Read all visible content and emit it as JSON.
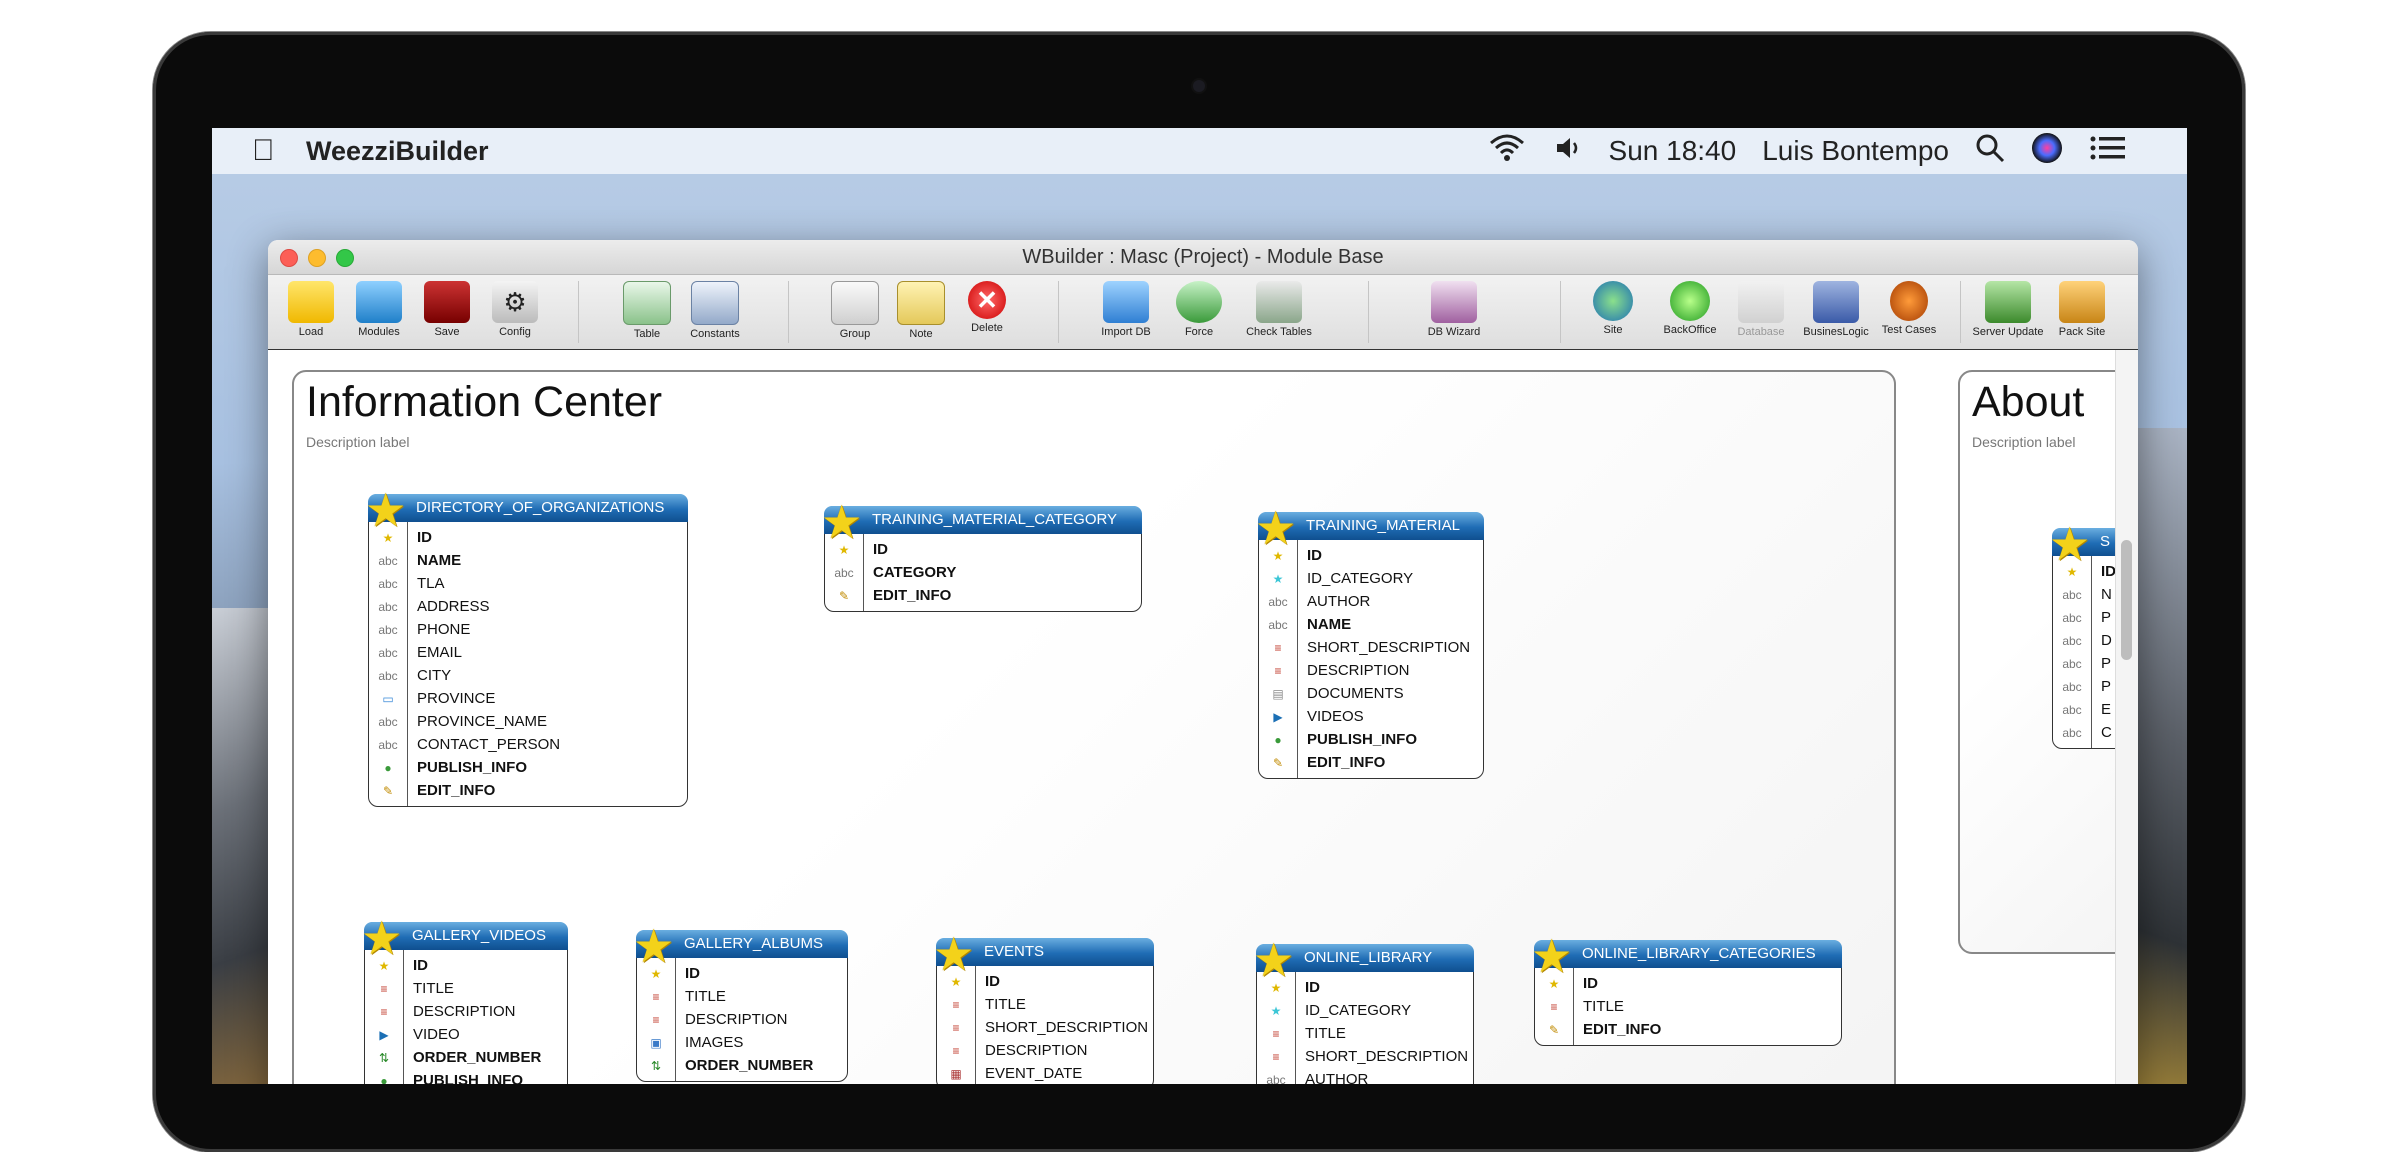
{
  "menubar": {
    "app_name": "WeezziBuilder",
    "clock": "Sun 18:40",
    "user": "Luis Bontempo"
  },
  "window": {
    "title": "WBuilder : Masc (Project) - Module Base"
  },
  "toolbar": {
    "load": "Load",
    "modules": "Modules",
    "save": "Save",
    "config": "Config",
    "table": "Table",
    "constants": "Constants",
    "group": "Group",
    "note": "Note",
    "delete": "Delete",
    "import_db": "Import DB",
    "force": "Force",
    "check_tables": "Check Tables",
    "db_wizard": "DB Wizard",
    "site": "Site",
    "backoffice": "BackOffice",
    "database": "Database",
    "businesslogic": "BusinesLogic",
    "test_cases": "Test Cases",
    "server_update": "Server Update",
    "pack_site": "Pack Site"
  },
  "groups": {
    "info": {
      "title": "Information Center",
      "desc": "Description label"
    },
    "about": {
      "title": "About",
      "desc": "Description label"
    }
  },
  "entities": {
    "directory": {
      "name": "DIRECTORY_OF_ORGANIZATIONS",
      "fields": [
        "ID",
        "NAME",
        "TLA",
        "ADDRESS",
        "PHONE",
        "EMAIL",
        "CITY",
        "PROVINCE",
        "PROVINCE_NAME",
        "CONTACT_PERSON",
        "PUBLISH_INFO",
        "EDIT_INFO"
      ]
    },
    "training_cat": {
      "name": "TRAINING_MATERIAL_CATEGORY",
      "fields": [
        "ID",
        "CATEGORY",
        "EDIT_INFO"
      ]
    },
    "training": {
      "name": "TRAINING_MATERIAL",
      "fields": [
        "ID",
        "ID_CATEGORY",
        "AUTHOR",
        "NAME",
        "SHORT_DESCRIPTION",
        "DESCRIPTION",
        "DOCUMENTS",
        "VIDEOS",
        "PUBLISH_INFO",
        "EDIT_INFO"
      ]
    },
    "about_entity": {
      "name": "S",
      "fields": [
        "ID",
        "N",
        "P",
        "D",
        "P",
        "P",
        "E",
        "C"
      ]
    },
    "gallery_videos": {
      "name": "GALLERY_VIDEOS",
      "fields": [
        "ID",
        "TITLE",
        "DESCRIPTION",
        "VIDEO",
        "ORDER_NUMBER",
        "PUBLISH_INFO"
      ]
    },
    "gallery_albums": {
      "name": "GALLERY_ALBUMS",
      "fields": [
        "ID",
        "TITLE",
        "DESCRIPTION",
        "IMAGES",
        "ORDER_NUMBER"
      ]
    },
    "events": {
      "name": "EVENTS",
      "fields": [
        "ID",
        "TITLE",
        "SHORT_DESCRIPTION",
        "DESCRIPTION",
        "EVENT_DATE"
      ]
    },
    "online_library": {
      "name": "ONLINE_LIBRARY",
      "fields": [
        "ID",
        "ID_CATEGORY",
        "TITLE",
        "SHORT_DESCRIPTION",
        "AUTHOR"
      ]
    },
    "online_library_cat": {
      "name": "ONLINE_LIBRARY_CATEGORIES",
      "fields": [
        "ID",
        "TITLE",
        "EDIT_INFO"
      ]
    }
  }
}
